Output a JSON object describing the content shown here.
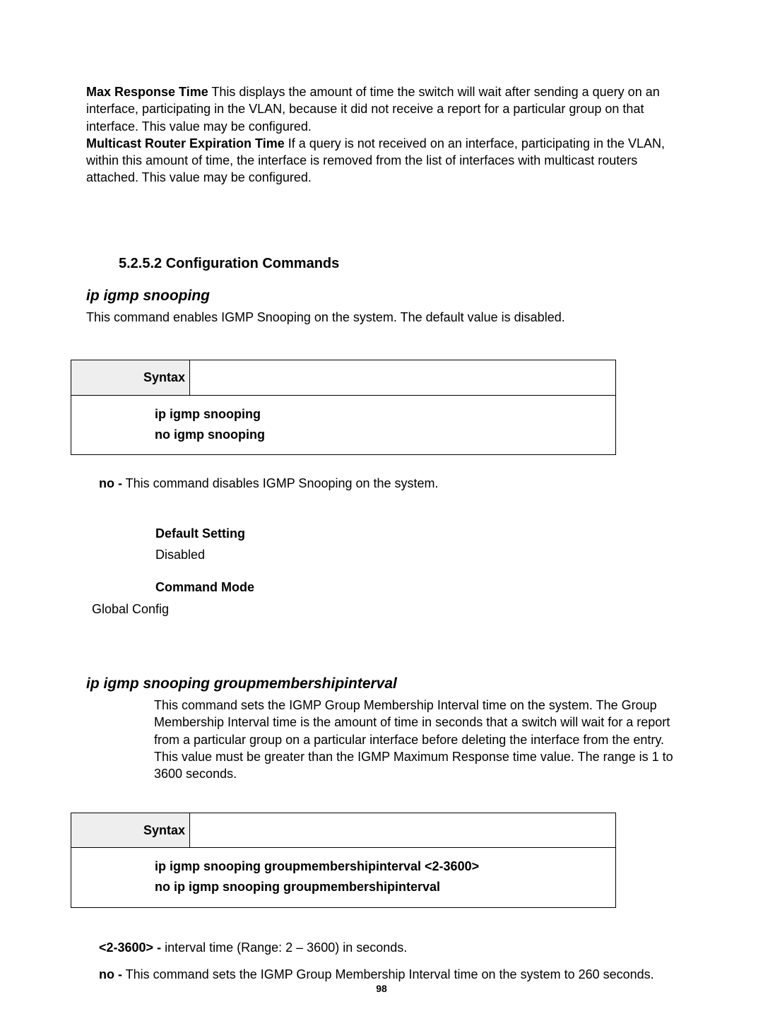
{
  "intro": {
    "p1_label": "Max Response Time",
    "p1_rest": " This displays the amount of time the switch will wait after sending a query on an interface, participating in the VLAN, because it did not receive a report for a particular group on that interface. This value may be configured.",
    "p2_label": "Multicast Router Expiration Time",
    "p2_rest": " If a query is not received on an interface, participating in the VLAN, within this amount of time, the interface is removed from the list of interfaces with multicast routers attached. This value may be configured."
  },
  "section_heading": "5.2.5.2 Configuration Commands",
  "cmd1": {
    "title": "ip igmp snooping",
    "desc": "This command enables IGMP Snooping on the system. The default value is disabled.",
    "syntax_label": "Syntax",
    "syntax_line1": "ip igmp snooping",
    "syntax_line2": "no igmp snooping",
    "no_label": "no -",
    "no_rest": " This command disables IGMP Snooping on the system.",
    "default_label": "Default Setting",
    "default_value": "Disabled",
    "mode_label": "Command Mode",
    "mode_value": "Global Config"
  },
  "cmd2": {
    "title": "ip igmp snooping groupmembershipinterval",
    "desc": "This command sets the IGMP Group Membership Interval time on the system. The Group Membership Interval time is the amount of time in seconds that a switch will wait for a report from a particular group on a particular interface before deleting the interface from the entry. This value must be greater than the IGMP Maximum Response time value. The range is 1 to 3600 seconds.",
    "syntax_label": "Syntax",
    "syntax_line1": "ip igmp snooping groupmembershipinterval <2-3600>",
    "syntax_line2": "no ip igmp snooping groupmembershipinterval",
    "param_label": "<2-3600> -",
    "param_rest": " interval time (Range: 2 – 3600) in seconds.",
    "no_label": "no -",
    "no_rest": " This command sets the IGMP Group Membership Interval time on the system to 260 seconds."
  },
  "page_number": "98"
}
